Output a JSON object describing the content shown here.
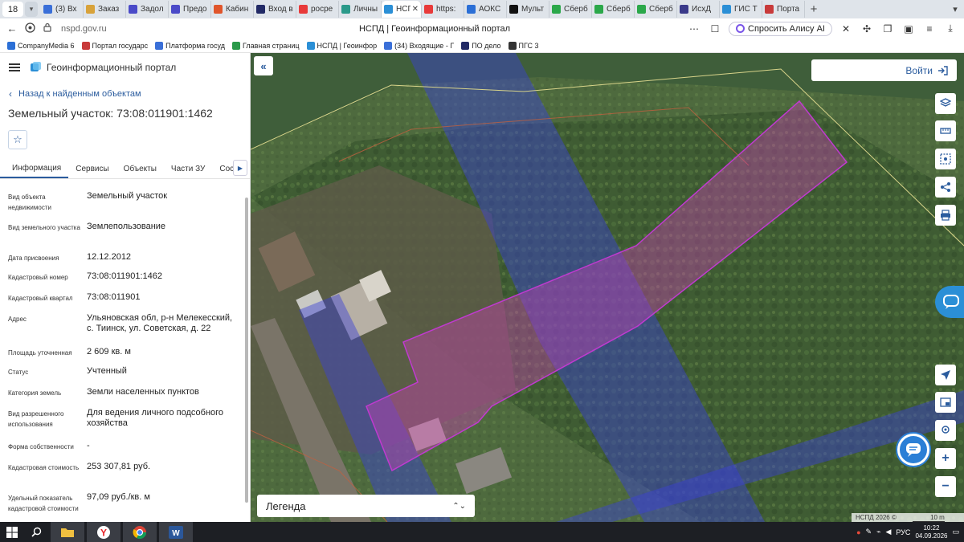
{
  "browser": {
    "tab_count": "18",
    "tabs": [
      {
        "label": "(3) Вх",
        "color": "#3a6fd8"
      },
      {
        "label": "Заказ",
        "color": "#d8a23a"
      },
      {
        "label": "Задол",
        "color": "#4a4ac8"
      },
      {
        "label": "Предо",
        "color": "#4a4ac8"
      },
      {
        "label": "Кабин",
        "color": "#e0552b"
      },
      {
        "label": "Вход в",
        "color": "#222a66"
      },
      {
        "label": "росре",
        "color": "#e83a3a"
      },
      {
        "label": "Личны",
        "color": "#2b9a8a"
      },
      {
        "label": "НСП",
        "color": "#2b8fd6",
        "active": true
      },
      {
        "label": "https:",
        "color": "#e83a3a"
      },
      {
        "label": "АОКС",
        "color": "#2b6fd6"
      },
      {
        "label": "Мульт",
        "color": "#111111"
      },
      {
        "label": "Сберб",
        "color": "#2ba84a"
      },
      {
        "label": "Сберб",
        "color": "#2ba84a"
      },
      {
        "label": "Сберб",
        "color": "#2ba84a"
      },
      {
        "label": "ИсхД",
        "color": "#3a3a8a"
      },
      {
        "label": "ГИС Т",
        "color": "#2b8fd6"
      },
      {
        "label": "Порта",
        "color": "#c83a3a"
      }
    ],
    "url": "nspd.gov.ru",
    "page_title": "НСПД | Геоинформационный портал",
    "alice_label": "Спросить Алису AI",
    "bookmarks": [
      {
        "label": "CompanyMedia 6",
        "color": "#2b6fd6"
      },
      {
        "label": "Портал государс",
        "color": "#c83a3a"
      },
      {
        "label": "Платформа госуд",
        "color": "#3a6fd8"
      },
      {
        "label": "Главная страниц",
        "color": "#2b9a4a"
      },
      {
        "label": "НСПД | Геоинфор",
        "color": "#2b8fd6"
      },
      {
        "label": "(34) Входящие - Г",
        "color": "#3a6fd8"
      },
      {
        "label": "ПО дело",
        "color": "#222a66"
      },
      {
        "label": "ПГС 3",
        "color": "#333333"
      }
    ]
  },
  "portal": {
    "name": "Геоинформационный портал",
    "back_label": "Назад к найденным объектам",
    "title": "Земельный участок: 73:08:011901:1462",
    "tabs": [
      "Информация",
      "Сервисы",
      "Объекты",
      "Части ЗУ",
      "Состав"
    ],
    "properties": [
      {
        "label": "Вид объекта недвижимости",
        "value": "Земельный участок"
      },
      {
        "label": "Вид земельного участка",
        "value": "Землепользование"
      },
      {
        "label": "Дата присвоения",
        "value": "12.12.2012"
      },
      {
        "label": "Кадастровый номер",
        "value": "73:08:011901:1462"
      },
      {
        "label": "Кадастровый квартал",
        "value": "73:08:011901"
      },
      {
        "label": "Адрес",
        "value": "Ульяновская обл, р-н Мелекесский, с. Тиинск, ул. Советская, д. 22"
      },
      {
        "label": "Площадь уточненная",
        "value": "2 609 кв. м"
      },
      {
        "label": "Статус",
        "value": "Учтенный"
      },
      {
        "label": "Категория земель",
        "value": "Земли населенных пунктов"
      },
      {
        "label": "Вид разрешенного использования",
        "value": "Для ведения личного подсобного хозяйства"
      },
      {
        "label": "Форма собственности",
        "value": "-"
      },
      {
        "label": "Кадастровая стоимость",
        "value": "253 307,81 руб."
      },
      {
        "label": "Удельный показатель кадастровой стоимости",
        "value": "97,09 руб./кв. м"
      }
    ]
  },
  "map": {
    "login_label": "Войти",
    "legend_label": "Легенда",
    "copyright": "НСПД 2026 ©",
    "scale": "10 m"
  },
  "taskbar": {
    "lang": "РУС",
    "time": "10:22",
    "date": "04.09.2026"
  },
  "colors": {
    "accent": "#2b5c9e",
    "parcel_outline": "#c03ad0",
    "zone_overlay": "#3a40d8"
  }
}
